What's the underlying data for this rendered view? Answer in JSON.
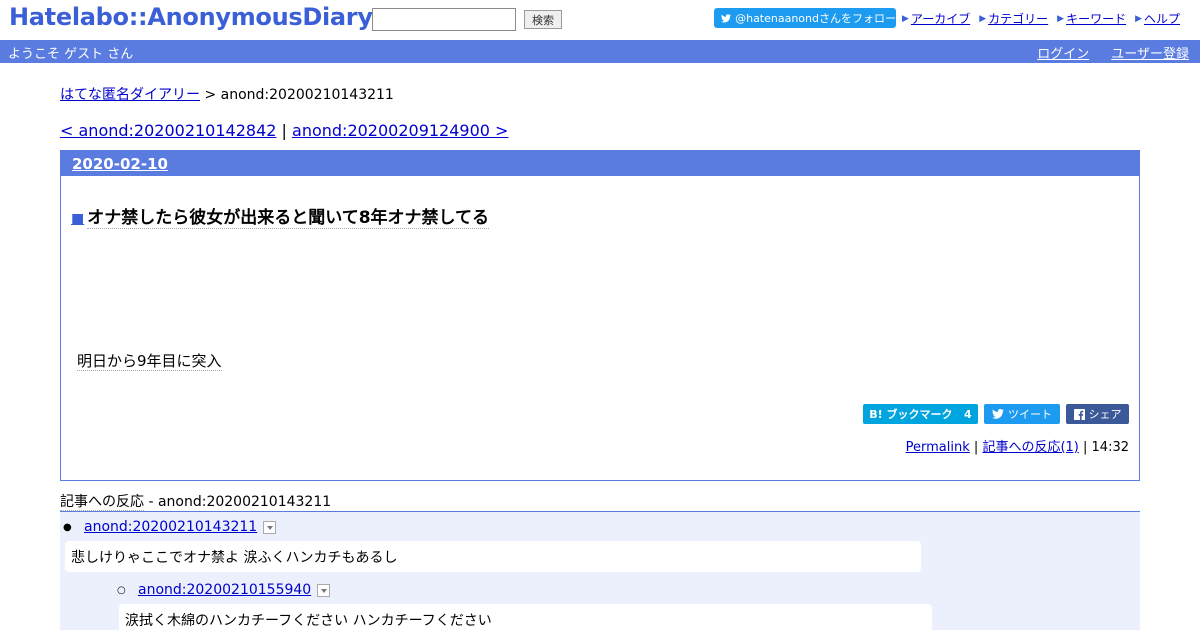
{
  "header": {
    "logo": "Hatelabo::AnonymousDiary",
    "search_button": "検索",
    "search_value": "",
    "follow_label": "@hatenaanondさんをフォロー",
    "links": [
      "アーカイブ",
      "カテゴリー",
      "キーワード",
      "ヘルプ"
    ]
  },
  "welcome": {
    "greeting": "ようこそ ゲスト さん",
    "login": "ログイン",
    "register": "ユーザー登録"
  },
  "breadcrumb": {
    "home": "はてな匿名ダイアリー",
    "separator": ">",
    "current": "anond:20200210143211"
  },
  "nav": {
    "prev": "< anond:20200210142842",
    "divider": "|",
    "next": "anond:20200209124900 >"
  },
  "entry": {
    "date": "2020-02-10",
    "title_marker": "■",
    "title": "オナ禁したら彼女が出来ると聞いて8年オナ禁してる",
    "body": "明日から9年目に突入",
    "bookmark_label": "B! ブックマーク",
    "bookmark_count": "4",
    "tweet_label": "ツイート",
    "share_label": "シェア",
    "permalink": "Permalink",
    "reactions_link": "記事への反応(1)",
    "time": "14:32"
  },
  "responses": {
    "heading_label": "記事への反応",
    "heading_id": "- anond:20200210143211",
    "items": [
      {
        "id": "anond:20200210143211",
        "text": "悲しけりゃここでオナ禁よ 涙ふくハンカチもあるし"
      },
      {
        "id": "anond:20200210155940",
        "text": "涙拭く木綿のハンカチーフください ハンカチーフください"
      }
    ]
  },
  "colors": {
    "brand": "#5a7be0",
    "link": "#0000cc",
    "response_bg": "#ebf0fc",
    "hatebu": "#00a4de",
    "twitter": "#1d9bf0",
    "facebook": "#3b5998"
  },
  "icons": [
    "twitter-bird-icon",
    "arrow-right-icon",
    "facebook-icon",
    "dropdown-toggle-icon"
  ]
}
